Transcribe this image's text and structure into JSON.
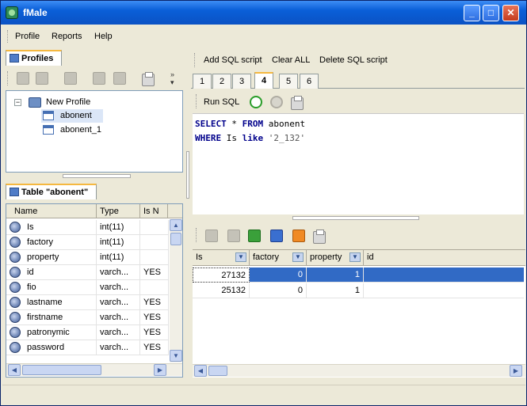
{
  "window": {
    "title": "fMale",
    "icon": "app-icon",
    "controls": [
      "minimize-icon",
      "maximize-icon",
      "close-icon"
    ]
  },
  "menu": {
    "items": [
      "Profile",
      "Reports",
      "Help"
    ]
  },
  "profiles_panel": {
    "tab_label": "Profiles",
    "tree": {
      "root_label": "New Profile",
      "children": [
        "abonent",
        "abonent_1"
      ]
    }
  },
  "table_panel": {
    "tab_label": "Table \"abonent\"",
    "columns": [
      "Name",
      "Type",
      "Is N"
    ],
    "rows": [
      {
        "name": "Is",
        "type": "int(11)",
        "is_null": ""
      },
      {
        "name": "factory",
        "type": "int(11)",
        "is_null": ""
      },
      {
        "name": "property",
        "type": "int(11)",
        "is_null": ""
      },
      {
        "name": "id",
        "type": "varch...",
        "is_null": "YES"
      },
      {
        "name": "fio",
        "type": "varch...",
        "is_null": ""
      },
      {
        "name": "lastname",
        "type": "varch...",
        "is_null": "YES"
      },
      {
        "name": "firstname",
        "type": "varch...",
        "is_null": "YES"
      },
      {
        "name": "patronymic",
        "type": "varch...",
        "is_null": "YES"
      },
      {
        "name": "password",
        "type": "varch...",
        "is_null": "YES"
      }
    ]
  },
  "sql_toolbar": {
    "add_label": "Add SQL script",
    "clear_label": "Clear ALL",
    "delete_label": "Delete SQL script"
  },
  "sql_tabs": [
    "1",
    "2",
    "3",
    "4",
    "5",
    "6"
  ],
  "sql_tab_active": "4",
  "run_toolbar": {
    "run_label": "Run SQL"
  },
  "sql": {
    "line1_kw1": "SELECT",
    "line1_mid": " * ",
    "line1_kw2": "FROM",
    "line1_rest": " abonent",
    "line2_kw1": "WHERE",
    "line2_mid": " Is ",
    "line2_kw2": "like",
    "line2_str": " '2_132'"
  },
  "results": {
    "columns": [
      "Is",
      "factory",
      "property",
      "id"
    ],
    "rows": [
      {
        "is": "27132",
        "factory": "0",
        "property": "1",
        "id": ""
      },
      {
        "is": "25132",
        "factory": "0",
        "property": "1",
        "id": ""
      }
    ]
  },
  "colors": {
    "title_bar": "#0b52c4",
    "selection": "#316ac5",
    "tab_accent": "#f5b840"
  }
}
